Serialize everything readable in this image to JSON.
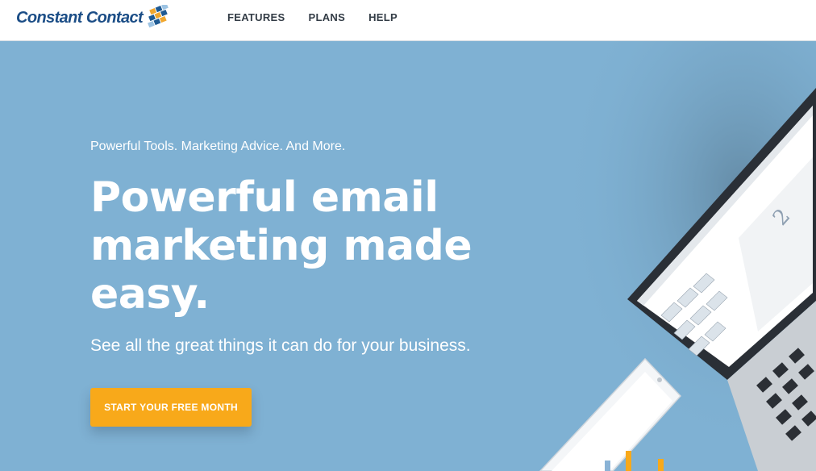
{
  "header": {
    "logo_text": "Constant Contact",
    "nav": [
      "FEATURES",
      "PLANS",
      "HELP"
    ]
  },
  "hero": {
    "eyebrow": "Powerful Tools. Marketing Advice. And More.",
    "headline_lines": [
      "Powerful email",
      "marketing made",
      "easy."
    ],
    "subheadline": "See all the great things it can do for your business.",
    "cta_label": "START YOUR FREE MONTH"
  },
  "colors": {
    "hero_background": "#7fb1d3",
    "cta": "#f8a91a",
    "logo_blue": "#1b4d86",
    "nav_text": "#333c46"
  }
}
